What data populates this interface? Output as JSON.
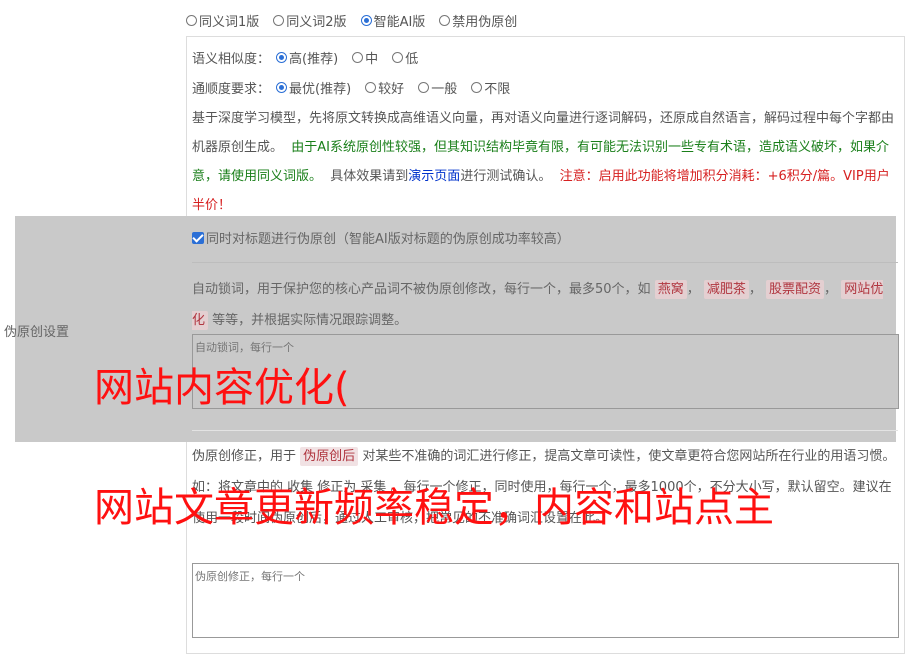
{
  "mode_options": [
    {
      "label": "同义词1版",
      "checked": false
    },
    {
      "label": "同义词2版",
      "checked": false
    },
    {
      "label": "智能AI版",
      "checked": true
    },
    {
      "label": "禁用伪原创",
      "checked": false
    }
  ],
  "similarity": {
    "label": "语义相似度：",
    "options": [
      {
        "label": "高(推荐)",
        "checked": true
      },
      {
        "label": "中",
        "checked": false
      },
      {
        "label": "低",
        "checked": false
      }
    ]
  },
  "fluency": {
    "label": "通顺度要求：",
    "options": [
      {
        "label": "最优(推荐)",
        "checked": true
      },
      {
        "label": "较好",
        "checked": false
      },
      {
        "label": "一般",
        "checked": false
      },
      {
        "label": "不限",
        "checked": false
      }
    ]
  },
  "description": {
    "part1": "基于深度学习模型，先将原文转换成高维语义向量，再对语义向量进行逐词解码，还原成自然语言，解码过程中每个字都由机器原创生成。",
    "part2_green": "由于AI系统原创性较强，但其知识结构毕竟有限，有可能无法识别一些专有术语，造成语义破坏，如果介意，请使用同义词版。",
    "part3": "具体效果请到",
    "link": "演示页面",
    "part4": "进行测试确认。",
    "part5_red": "注意：启用此功能将增加积分消耗：+6积分/篇。VIP用户半价！"
  },
  "side_label": "伪原创设置",
  "title_checkbox": {
    "label": "同时对标题进行伪原创（智能AI版对标题的伪原创成功率较高）",
    "checked": true
  },
  "lock_words": {
    "desc_before": "自动锁词，用于保护您的核心产品词不被伪原创修改，每行一个，最多50个，如",
    "tags": [
      "燕窝",
      "减肥茶",
      "股票配资",
      "网站优化"
    ],
    "sep": "，",
    "desc_after": "等等，并根据实际情况跟踪调整。",
    "placeholder": "自动锁词，每行一个"
  },
  "fix_words": {
    "desc_before": "伪原创修正，用于",
    "tag": "伪原创后",
    "desc_after": "对某些不准确的词汇进行修正，提高文章可读性，使文章更符合您网站所在行业的用语习惯。如：将文章中的 收集 修正为 采集 。每行一个修正，同时使用，每行一个，最多1000个，不分大小写，默认留空。建议在使用一段时间伪原创后，通过人工审核，把常见的不准确词汇设置在此。",
    "placeholder": "伪原创修正，每行一个"
  },
  "watermark": {
    "line1": "网站内容优化(",
    "line2": "网站文章更新频率稳定，内容和站点主"
  },
  "colors": {
    "accent": "#2b6fd6",
    "green": "#1a7f1a",
    "red": "#d62020",
    "link": "#0033cc",
    "overlay": "#c9c9c9",
    "watermark": "#ff1010"
  }
}
